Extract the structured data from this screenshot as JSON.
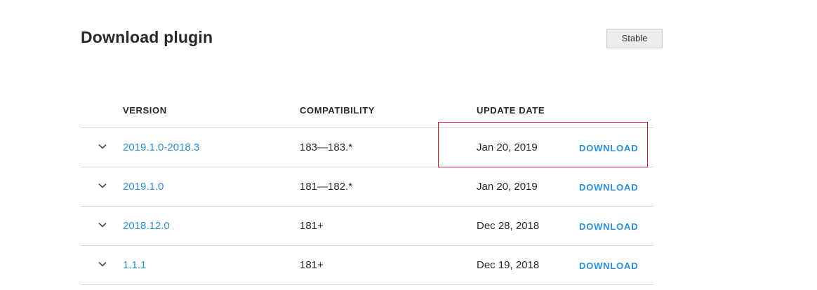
{
  "header": {
    "title": "Download plugin",
    "channel_button": "Stable"
  },
  "table": {
    "columns": {
      "version": "VERSION",
      "compatibility": "COMPATIBILITY",
      "update_date": "UPDATE DATE"
    },
    "rows": [
      {
        "version": "2019.1.0-2018.3",
        "compatibility": "183—183.*",
        "date": "Jan 20, 2019",
        "action": "DOWNLOAD"
      },
      {
        "version": "2019.1.0",
        "compatibility": "181—182.*",
        "date": "Jan 20, 2019",
        "action": "DOWNLOAD"
      },
      {
        "version": "2018.12.0",
        "compatibility": "181+",
        "date": "Dec 28, 2018",
        "action": "DOWNLOAD"
      },
      {
        "version": "1.1.1",
        "compatibility": "181+",
        "date": "Dec 19, 2018",
        "action": "DOWNLOAD"
      }
    ]
  },
  "icons": {
    "row_toggle": "chevron-down-icon"
  },
  "colors": {
    "link": "#2f8ed8",
    "text": "#27282c",
    "divider": "#d6d6d6",
    "highlight_annotation": "#c0282d"
  }
}
